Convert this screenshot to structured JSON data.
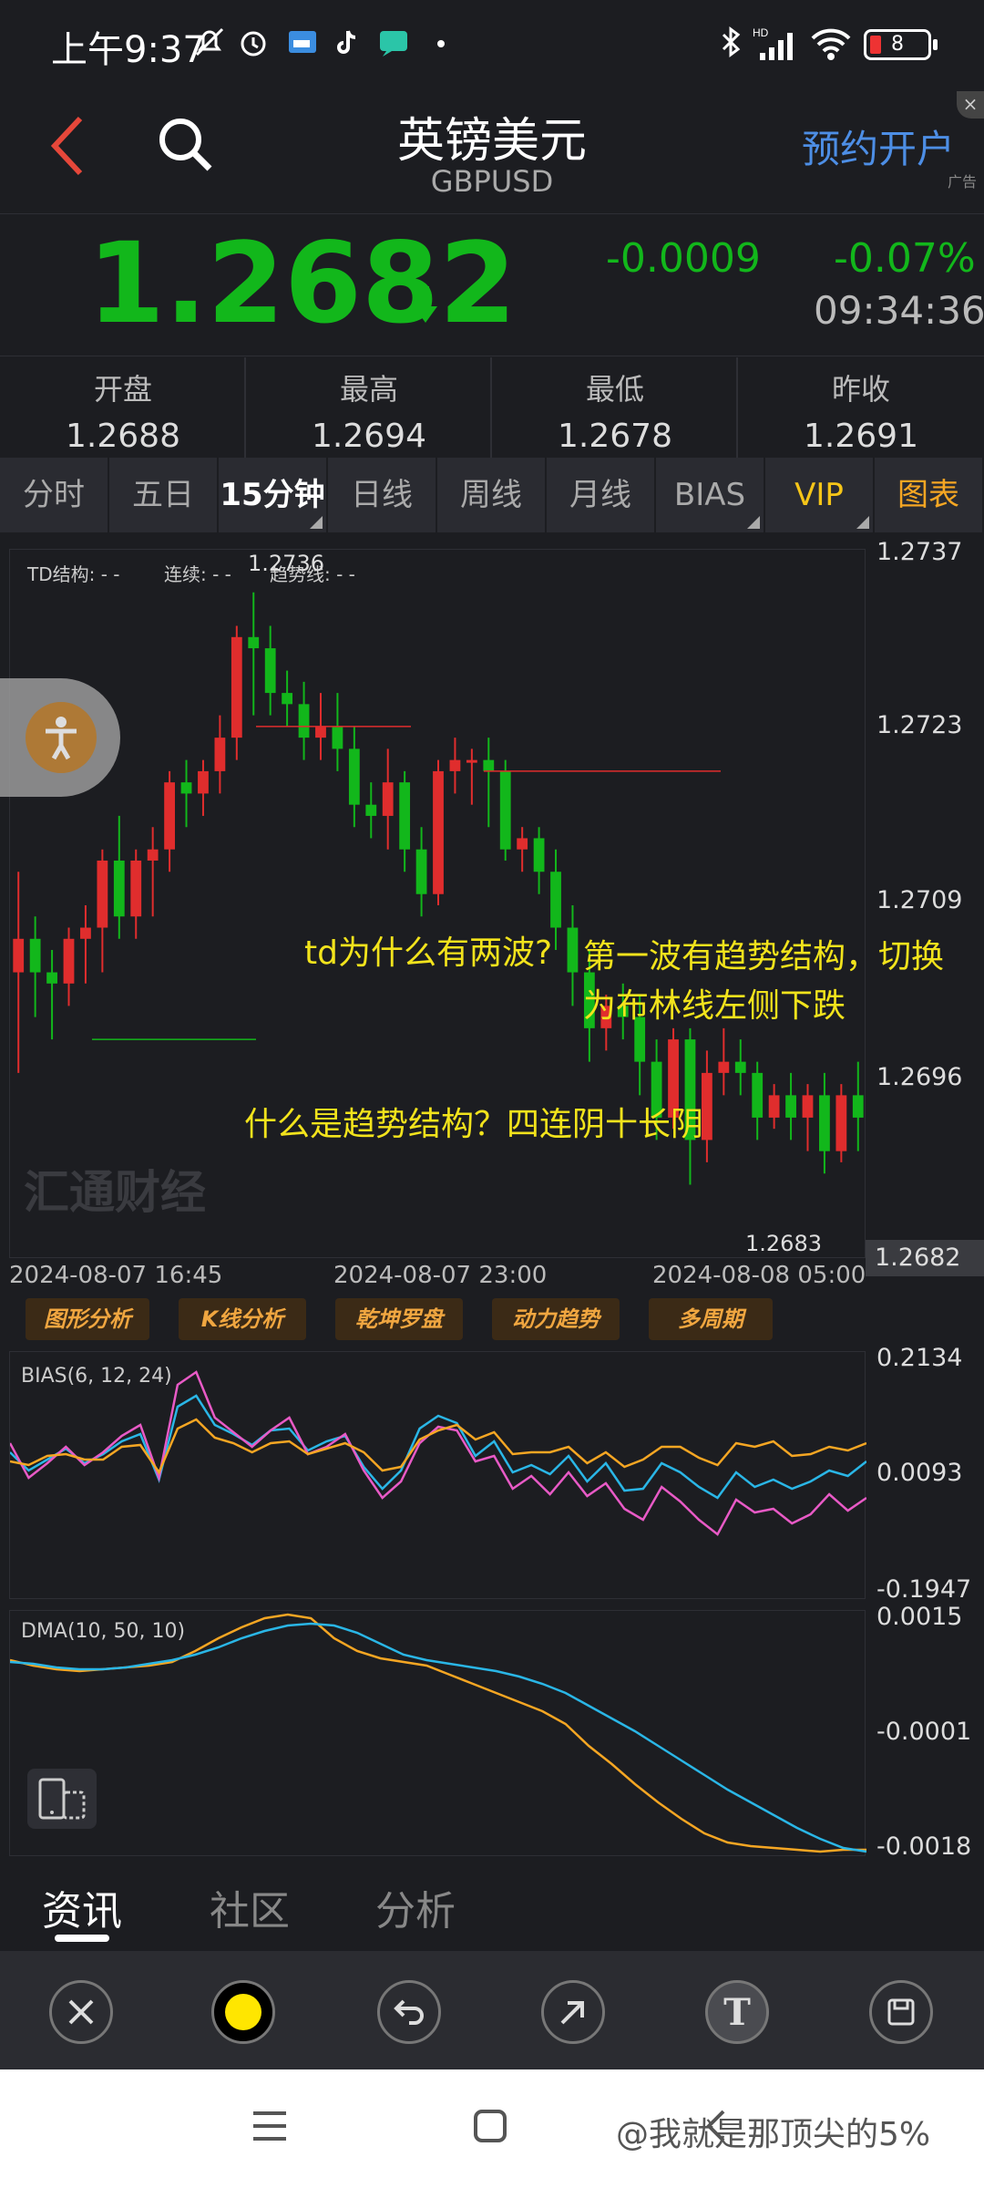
{
  "status_bar": {
    "time": "上午9:37",
    "battery": "8"
  },
  "header": {
    "title": "英镑美元",
    "subtitle": "GBPUSD",
    "open_account": "预约开户",
    "ad_label": "广告",
    "ad_close": "×"
  },
  "quote": {
    "price": "1.2682",
    "change": "-0.0009",
    "change_pct": "-0.07%",
    "time": "09:34:36",
    "color_down": "#12b71b",
    "color_up": "#e02d2d"
  },
  "stats": [
    {
      "label": "开盘",
      "value": "1.2688"
    },
    {
      "label": "最高",
      "value": "1.2694"
    },
    {
      "label": "最低",
      "value": "1.2678"
    },
    {
      "label": "昨收",
      "value": "1.2691"
    }
  ],
  "tabs": [
    "分时",
    "五日",
    "15分钟",
    "日线",
    "周线",
    "月线",
    "BIAS",
    "VIP",
    "图表"
  ],
  "chart": {
    "y_labels": [
      "1.2737",
      "1.2723",
      "1.2709",
      "1.2696",
      "1.2682"
    ],
    "x_labels": [
      "2024-08-07 16:45",
      "2024-08-07 23:00",
      "2024-08-08 05:00"
    ],
    "td_structure": "TD结构: - -",
    "td_consec": "连续: - -",
    "td_trend": "趋势线: - -",
    "high_mark": "1.2736",
    "low_mark": "1.2683",
    "watermark": "汇通财经",
    "notes": [
      "td为什么有两波?",
      "第一波有趋势结构，切换",
      "为布林线左侧下跌",
      "什么是趋势结构？四连阴十长阴"
    ]
  },
  "chart_data": {
    "type": "candlestick",
    "ylim": [
      1.2678,
      1.274
    ],
    "y_ticks": [
      1.2737,
      1.2723,
      1.2709,
      1.2696,
      1.2682
    ],
    "x_ticks": [
      "2024-08-07 16:45",
      "2024-08-07 23:00",
      "2024-08-08 05:00"
    ],
    "candles": [
      [
        1.2703,
        1.2706,
        1.2694,
        1.2712
      ],
      [
        1.2706,
        1.2703,
        1.2699,
        1.2708
      ],
      [
        1.2703,
        1.2702,
        1.2697,
        1.2705
      ],
      [
        1.2702,
        1.2706,
        1.27,
        1.2707
      ],
      [
        1.2706,
        1.2707,
        1.2702,
        1.2709
      ],
      [
        1.2707,
        1.2713,
        1.2703,
        1.2714
      ],
      [
        1.2713,
        1.2708,
        1.2706,
        1.2717
      ],
      [
        1.2708,
        1.2713,
        1.2706,
        1.2714
      ],
      [
        1.2713,
        1.2714,
        1.2708,
        1.2716
      ],
      [
        1.2714,
        1.272,
        1.2712,
        1.2721
      ],
      [
        1.272,
        1.2719,
        1.2716,
        1.2722
      ],
      [
        1.2719,
        1.2721,
        1.2717,
        1.2722
      ],
      [
        1.2721,
        1.2724,
        1.2719,
        1.2726
      ],
      [
        1.2724,
        1.2733,
        1.2722,
        1.2734
      ],
      [
        1.2733,
        1.2732,
        1.2726,
        1.2737
      ],
      [
        1.2732,
        1.2728,
        1.2726,
        1.2734
      ],
      [
        1.2728,
        1.2727,
        1.2725,
        1.273
      ],
      [
        1.2727,
        1.2724,
        1.2722,
        1.2729
      ],
      [
        1.2724,
        1.2725,
        1.2722,
        1.2728
      ],
      [
        1.2725,
        1.2723,
        1.2721,
        1.2728
      ],
      [
        1.2723,
        1.2718,
        1.2716,
        1.2725
      ],
      [
        1.2718,
        1.2717,
        1.2715,
        1.272
      ],
      [
        1.2717,
        1.272,
        1.2714,
        1.2723
      ],
      [
        1.272,
        1.2714,
        1.2712,
        1.2721
      ],
      [
        1.2714,
        1.271,
        1.2708,
        1.2716
      ],
      [
        1.271,
        1.2721,
        1.2709,
        1.2722
      ],
      [
        1.2721,
        1.2722,
        1.2719,
        1.2724
      ],
      [
        1.2722,
        1.2722,
        1.2718,
        1.2723
      ],
      [
        1.2722,
        1.2721,
        1.2716,
        1.2724
      ],
      [
        1.2721,
        1.2714,
        1.2713,
        1.2722
      ],
      [
        1.2714,
        1.2715,
        1.2712,
        1.2716
      ],
      [
        1.2715,
        1.2712,
        1.271,
        1.2716
      ],
      [
        1.2712,
        1.2707,
        1.2705,
        1.2714
      ],
      [
        1.2707,
        1.2703,
        1.27,
        1.2709
      ],
      [
        1.2703,
        1.2698,
        1.2695,
        1.2705
      ],
      [
        1.2698,
        1.27,
        1.2696,
        1.2701
      ],
      [
        1.27,
        1.2699,
        1.2697,
        1.2702
      ],
      [
        1.2699,
        1.2695,
        1.2692,
        1.2701
      ],
      [
        1.2695,
        1.269,
        1.2688,
        1.2697
      ],
      [
        1.269,
        1.2697,
        1.2689,
        1.2698
      ],
      [
        1.2697,
        1.2688,
        1.2684,
        1.2698
      ],
      [
        1.2688,
        1.2694,
        1.2686,
        1.2696
      ],
      [
        1.2694,
        1.2695,
        1.2692,
        1.2698
      ],
      [
        1.2695,
        1.2694,
        1.2692,
        1.2697
      ],
      [
        1.2694,
        1.269,
        1.2688,
        1.2695
      ],
      [
        1.269,
        1.2692,
        1.2689,
        1.2693
      ],
      [
        1.2692,
        1.269,
        1.2688,
        1.2694
      ],
      [
        1.269,
        1.2692,
        1.2687,
        1.2693
      ],
      [
        1.2692,
        1.2687,
        1.2685,
        1.2694
      ],
      [
        1.2687,
        1.2692,
        1.2686,
        1.2693
      ],
      [
        1.2692,
        1.269,
        1.2687,
        1.2695
      ]
    ],
    "bias": {
      "label": "BIAS(6, 12, 24)",
      "y_ticks": [
        "0.2134",
        "0.0093",
        "-0.1947"
      ]
    },
    "dma": {
      "label": "DMA(10, 50, 10)",
      "y_ticks": [
        "0.0015",
        "-0.0001",
        "-0.0018"
      ]
    }
  },
  "analysis_buttons": [
    "图形分析",
    "K线分析",
    "乾坤罗盘",
    "动力趋势",
    "多周期"
  ],
  "bottom_tabs": [
    "资讯",
    "社区",
    "分析"
  ],
  "toolbar": {
    "text_tool": "T"
  },
  "credit": "@我就是那顶尖的5%"
}
